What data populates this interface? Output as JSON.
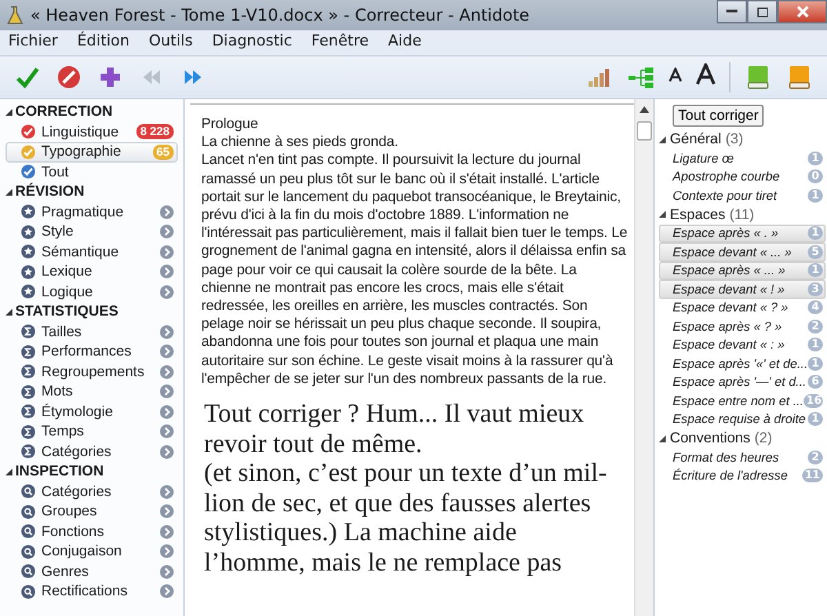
{
  "window": {
    "title": "« Heaven Forest - Tome 1-V10.docx » - Correcteur - Antidote"
  },
  "menu": [
    "Fichier",
    "Édition",
    "Outils",
    "Diagnostic",
    "Fenêtre",
    "Aide"
  ],
  "toolbar": {
    "back_disabled": true,
    "forward_disabled": false
  },
  "sidebar": {
    "sections": [
      {
        "title": "CORRECTION",
        "kind": "correction",
        "items": [
          {
            "label": "Linguistique",
            "badge": "8 228",
            "color": "#e03c3c",
            "selected": false
          },
          {
            "label": "Typographie",
            "badge": "65",
            "color": "#e8b030",
            "selected": true
          },
          {
            "label": "Tout",
            "color": "#3c78c8",
            "selected": false
          }
        ]
      },
      {
        "title": "RÉVISION",
        "kind": "revision",
        "items": [
          {
            "label": "Pragmatique",
            "selected": false
          },
          {
            "label": "Style",
            "selected": false
          },
          {
            "label": "Sémantique",
            "selected": false
          },
          {
            "label": "Lexique",
            "selected": false
          },
          {
            "label": "Logique",
            "selected": false
          }
        ]
      },
      {
        "title": "STATISTIQUES",
        "kind": "statistics",
        "items": [
          {
            "label": "Tailles",
            "selected": false
          },
          {
            "label": "Performances",
            "selected": false
          },
          {
            "label": "Regroupements",
            "selected": false
          },
          {
            "label": "Mots",
            "selected": false
          },
          {
            "label": "Étymologie",
            "selected": false
          },
          {
            "label": "Temps",
            "selected": false
          },
          {
            "label": "Catégories",
            "selected": false
          }
        ]
      },
      {
        "title": "INSPECTION",
        "kind": "inspection",
        "items": [
          {
            "label": "Catégories",
            "selected": false
          },
          {
            "label": "Groupes",
            "selected": false
          },
          {
            "label": "Fonctions",
            "selected": false
          },
          {
            "label": "Conjugaison",
            "selected": false
          },
          {
            "label": "Genres",
            "selected": false
          },
          {
            "label": "Rectifications",
            "selected": false
          }
        ]
      }
    ]
  },
  "document": {
    "paragraphs": [
      "Prologue",
      "La chienne à ses pieds gronda.",
      "Lancet n'en tint pas compte. Il poursuivit la lecture du journal ramassé un peu plus tôt sur le banc où il s'était installé. L'article portait sur le lancement du paquebot transocéanique, le Breytainic, prévu d'ici à la fin du mois d'octobre 1889. L'information ne l'intéressait pas particulièrement, mais il fallait bien tuer le temps. Le grognement de l'animal gagna en intensité, alors il délaissa enfin sa page pour voir ce qui causait la colère sourde de la bête. La chienne ne montrait pas encore les crocs, mais elle s'était redressée, les oreilles en arrière, les muscles contractés. Son pelage noir se hérissait un peu plus chaque seconde. Il soupira, abandonna une fois pour toutes son journal et plaqua une main autoritaire sur son échine. Le geste visait moins à la rassurer qu'à l'empêcher de se jeter sur l'un des nombreux passants de la rue."
    ]
  },
  "caption": {
    "lines": [
      "Tout corriger ? Hum... Il vaut mieux",
      "revoir tout de même.",
      "(et sinon, c’est pour un texte d’un mil-",
      "lion de sec, et que des fausses alertes",
      "stylistiques.) La machine aide",
      "l’homme, mais le ne remplace pas"
    ]
  },
  "panel": {
    "button": "Tout corriger",
    "groups": [
      {
        "title": "Général",
        "count": "(3)",
        "expanded": true,
        "items": [
          {
            "label": "Ligature œ",
            "badge": "1",
            "selected": false
          },
          {
            "label": "Apostrophe courbe",
            "badge": "0",
            "selected": false
          },
          {
            "label": "Contexte pour tiret",
            "badge": "1",
            "selected": false
          }
        ]
      },
      {
        "title": "Espaces",
        "count": "(11)",
        "expanded": true,
        "items": [
          {
            "label": "Espace après « . »",
            "badge": "1",
            "selected": true
          },
          {
            "label": "Espace devant « ... »",
            "badge": "5",
            "selected": true
          },
          {
            "label": "Espace après « ... »",
            "badge": "1",
            "selected": true
          },
          {
            "label": "Espace devant « ! »",
            "badge": "3",
            "selected": true
          },
          {
            "label": "Espace devant « ? »",
            "badge": "4",
            "selected": false
          },
          {
            "label": "Espace après « ? »",
            "badge": "2",
            "selected": false
          },
          {
            "label": "Espace devant « : »",
            "badge": "1",
            "selected": false
          },
          {
            "label": "Espace après '«' et de...",
            "badge": "1",
            "selected": false
          },
          {
            "label": "Espace après '—' et d...",
            "badge": "6",
            "selected": false
          },
          {
            "label": "Espace entre nom et ...",
            "badge": "16",
            "selected": false
          },
          {
            "label": "Espace requise à droite",
            "badge": "1",
            "selected": false
          }
        ]
      },
      {
        "title": "Conventions",
        "count": "(2)",
        "expanded": true,
        "items": [
          {
            "label": "Format des heures",
            "badge": "2",
            "selected": false
          },
          {
            "label": "Écriture de l'adresse",
            "badge": "11",
            "selected": false
          }
        ]
      }
    ]
  }
}
